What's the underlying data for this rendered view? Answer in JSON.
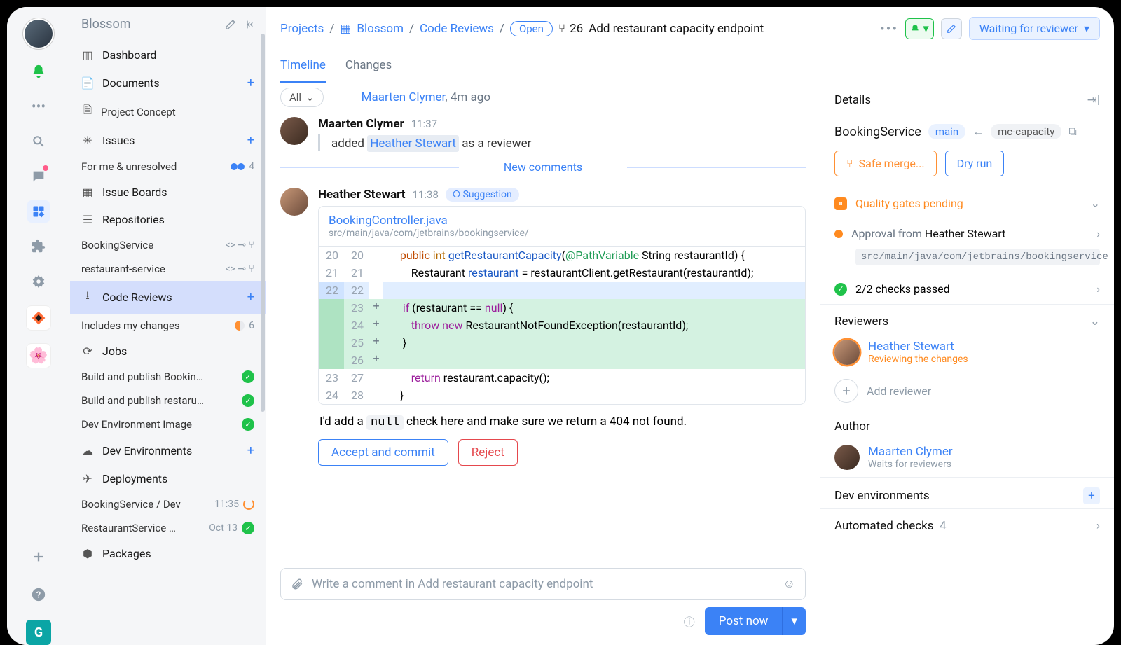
{
  "project_name": "Blossom",
  "sidebar": {
    "dashboard": "Dashboard",
    "documents": "Documents",
    "project_concept": "Project Concept",
    "issues": "Issues",
    "for_me_unresolved": "For me & unresolved",
    "for_me_count": "4",
    "issue_boards": "Issue Boards",
    "repositories": "Repositories",
    "repo1": "BookingService",
    "repo2": "restaurant-service",
    "code_reviews": "Code Reviews",
    "includes_my_changes": "Includes my changes",
    "includes_count": "6",
    "jobs": "Jobs",
    "job1": "Build and publish Bookin…",
    "job2": "Build and publish restaru…",
    "job3": "Dev Environment Image",
    "dev_env": "Dev Environments",
    "deployments": "Deployments",
    "dep1": "BookingService / Dev",
    "dep1_time": "11:35",
    "dep2": "RestaurantService …",
    "dep2_time": "Oct 13",
    "packages": "Packages"
  },
  "breadcrumb": {
    "projects": "Projects",
    "blossom": "Blossom",
    "code_reviews": "Code Reviews",
    "open": "Open",
    "pr_num": "26",
    "title": "Add restaurant capacity endpoint",
    "status": "Waiting for reviewer"
  },
  "tabs": {
    "timeline": "Timeline",
    "changes": "Changes"
  },
  "filter_all": "All",
  "header_line": {
    "name": "Maarten Clymer",
    "time": ", 4m ago"
  },
  "event1": {
    "name": "Maarten Clymer",
    "time": "11:37",
    "text_prefix": "added ",
    "highlight": "Heather Stewart",
    "text_suffix": " as a reviewer"
  },
  "new_comments": "New comments",
  "event2": {
    "name": "Heather Stewart",
    "time": "11:38",
    "tag": "⭘ Suggestion",
    "file": "BookingController.java",
    "path": "src/main/java/com/jetbrains/bookingservice/",
    "comment_pre": "I'd add a ",
    "comment_code": "null",
    "comment_post": " check here and make sure we return a 404 not found.",
    "accept": "Accept and commit",
    "reject": "Reject"
  },
  "code": {
    "l20a": "20",
    "l20b": "20",
    "l21a": "21",
    "l21b": "21",
    "l22a": "22",
    "l22b": "22",
    "l23b": "23",
    "l24b": "24",
    "l25b": "25",
    "l26b": "26",
    "l23a": "23",
    "l27b": "27",
    "l24a": "24",
    "l28b": "28"
  },
  "composer": {
    "placeholder": "Write a comment in Add restaurant capacity endpoint"
  },
  "post_now": "Post now",
  "details": {
    "title": "Details",
    "repo": "BookingService",
    "main": "main",
    "branch": "mc-capacity",
    "safe_merge": "Safe merge...",
    "dry_run": "Dry run",
    "quality": "Quality gates pending",
    "approval_from": "Approval from ",
    "approval_name": "Heather Stewart",
    "approval_path": "src/main/java/com/jetbrains/bookingservice",
    "checks": "2/2 checks passed",
    "reviewers": "Reviewers",
    "rev1": "Heather Stewart",
    "rev1_status": "Reviewing the changes",
    "add_reviewer": "Add reviewer",
    "author": "Author",
    "auth1": "Maarten Clymer",
    "auth1_status": "Waits for reviewers",
    "dev_envs": "Dev environments",
    "auto_checks": "Automated checks",
    "auto_count": "4"
  }
}
